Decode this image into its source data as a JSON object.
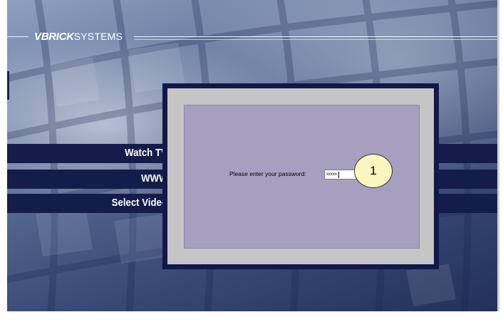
{
  "header": {
    "brand_bold": "VBRICK",
    "brand_light": "SYSTEMS"
  },
  "nav": {
    "items": [
      {
        "label": "Watch TV"
      },
      {
        "label": "WWW"
      },
      {
        "label": "Select Video"
      }
    ]
  },
  "login": {
    "prompt": "Please enter your password:",
    "password_value": "xxxxx"
  },
  "annotation": {
    "callout_number": "1"
  },
  "colors": {
    "nav_band": "#141d4a",
    "dialog_frame": "#10194a",
    "dialog_outer": "#c5c5c5",
    "dialog_inner": "#a79fbf",
    "callout_fill": "#fbf6c0"
  }
}
